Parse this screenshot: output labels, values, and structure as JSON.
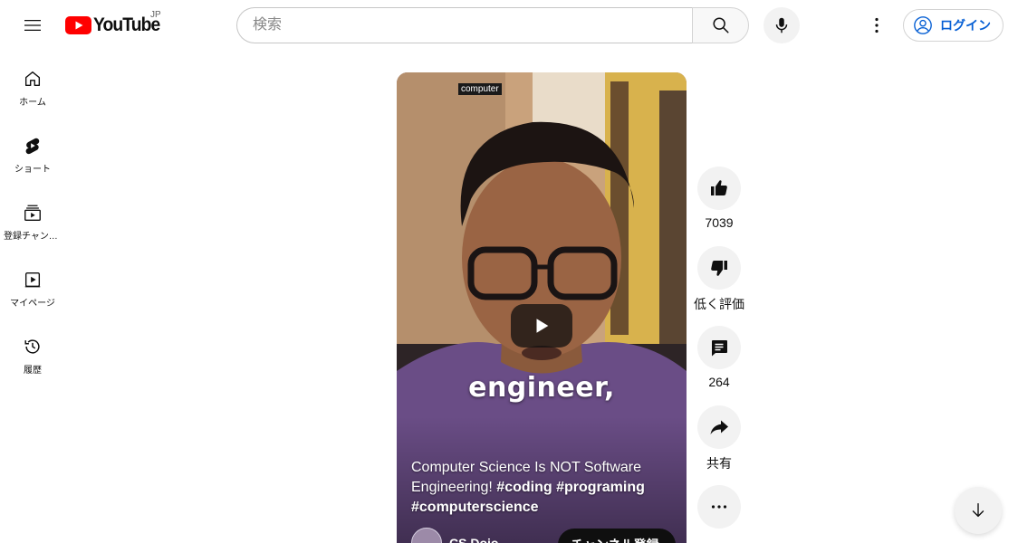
{
  "header": {
    "logo_text": "YouTube",
    "region": "JP",
    "search_placeholder": "検索",
    "login_label": "ログイン"
  },
  "sidebar": {
    "items": [
      {
        "label": "ホーム",
        "icon": "home-icon"
      },
      {
        "label": "ショート",
        "icon": "shorts-icon"
      },
      {
        "label": "登録チャンネル",
        "icon": "subscriptions-icon"
      },
      {
        "label": "マイページ",
        "icon": "you-icon"
      },
      {
        "label": "履歴",
        "icon": "history-icon"
      }
    ]
  },
  "video": {
    "chip": "computer",
    "caption": "engineer,",
    "title_plain": "Computer Science Is NOT Software Engineering! ",
    "hashtags": "#coding #programing #computerscience",
    "channel_name": "CS Dojo",
    "subscribe_label": "チャンネル登録"
  },
  "actions": {
    "like_count": "7039",
    "dislike_label": "低く評価",
    "comment_count": "264",
    "share_label": "共有"
  },
  "colors": {
    "brand_red": "#ff0000",
    "link_blue": "#065fd4",
    "shirt_purple": "#6a4d86"
  }
}
